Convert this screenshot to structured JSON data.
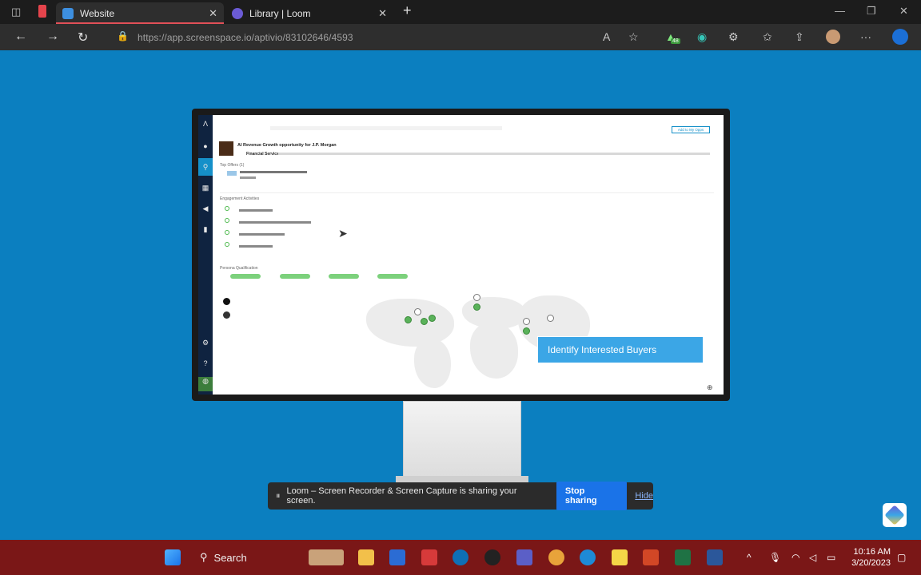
{
  "browser": {
    "tabs": [
      {
        "label": "Website",
        "active": true
      },
      {
        "label": "Library | Loom",
        "active": false
      }
    ],
    "url": "https://app.screenspace.io/aptivio/83102646/4593",
    "extension_badge": "48"
  },
  "app": {
    "title": "AI Revenue Growth opportunity for J.P. Morgan",
    "add_button": "Add to My Opps",
    "industry": "Financial Services",
    "sections": {
      "top_offers": "Top Offers (1)",
      "engagement": "Engagement Activities",
      "persona": "Persona Qualification"
    }
  },
  "overlay": {
    "label": "Identify Interested Buyers"
  },
  "loom": {
    "message": "Loom – Screen Recorder & Screen Capture is sharing your screen.",
    "stop_label": "Stop sharing",
    "hide_label": "Hide"
  },
  "taskbar": {
    "search_label": "Search",
    "time": "10:16 AM",
    "date": "3/20/2023"
  },
  "colors": {
    "background": "#0b7fc0",
    "taskbar": "#7a1717",
    "accent": "#1a73e8"
  }
}
